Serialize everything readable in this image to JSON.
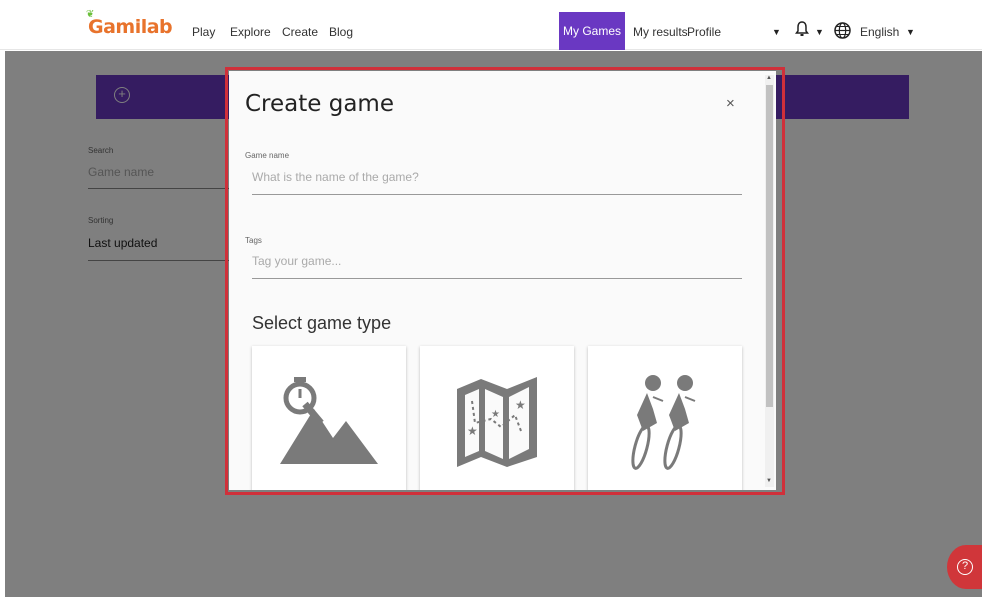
{
  "nav": {
    "logo": "Gamilab",
    "links": [
      "Play",
      "Explore",
      "Create",
      "Blog"
    ],
    "my_games": "My Games",
    "my_results": "My results",
    "profile": "Profile",
    "language": "English",
    "accent_color": "#6a38c2"
  },
  "sidebar": {
    "search_label": "Search",
    "search_placeholder": "Game name",
    "sorting_label": "Sorting",
    "sorting_value": "Last updated"
  },
  "modal": {
    "title": "Create game",
    "close": "×",
    "game_name_label": "Game name",
    "game_name_placeholder": "What is the name of the game?",
    "tags_label": "Tags",
    "tags_placeholder": "Tag your game...",
    "section_title": "Select game type",
    "cards": [
      {
        "icon": "timer-mountain-icon"
      },
      {
        "icon": "treasure-map-icon"
      },
      {
        "icon": "cyclists-icon"
      }
    ]
  },
  "help": {
    "icon": "help-icon"
  }
}
